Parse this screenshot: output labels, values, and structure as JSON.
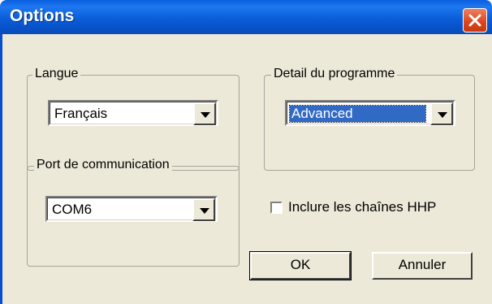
{
  "window": {
    "title": "Options",
    "close_icon": "close-x-icon"
  },
  "langue": {
    "label": "Langue",
    "selected": "Français"
  },
  "detail": {
    "label": "Detail du programme",
    "selected": "Advanced"
  },
  "port": {
    "label": "Port de communication",
    "selected": "COM6"
  },
  "hhp": {
    "label": "Inclure les chaînes HHP",
    "checked": false
  },
  "buttons": {
    "ok": "OK",
    "cancel": "Annuler"
  },
  "colors": {
    "titlebar": "#0a5fe0",
    "face": "#ece9d8",
    "selection": "#316ac5",
    "close": "#d8441c"
  }
}
